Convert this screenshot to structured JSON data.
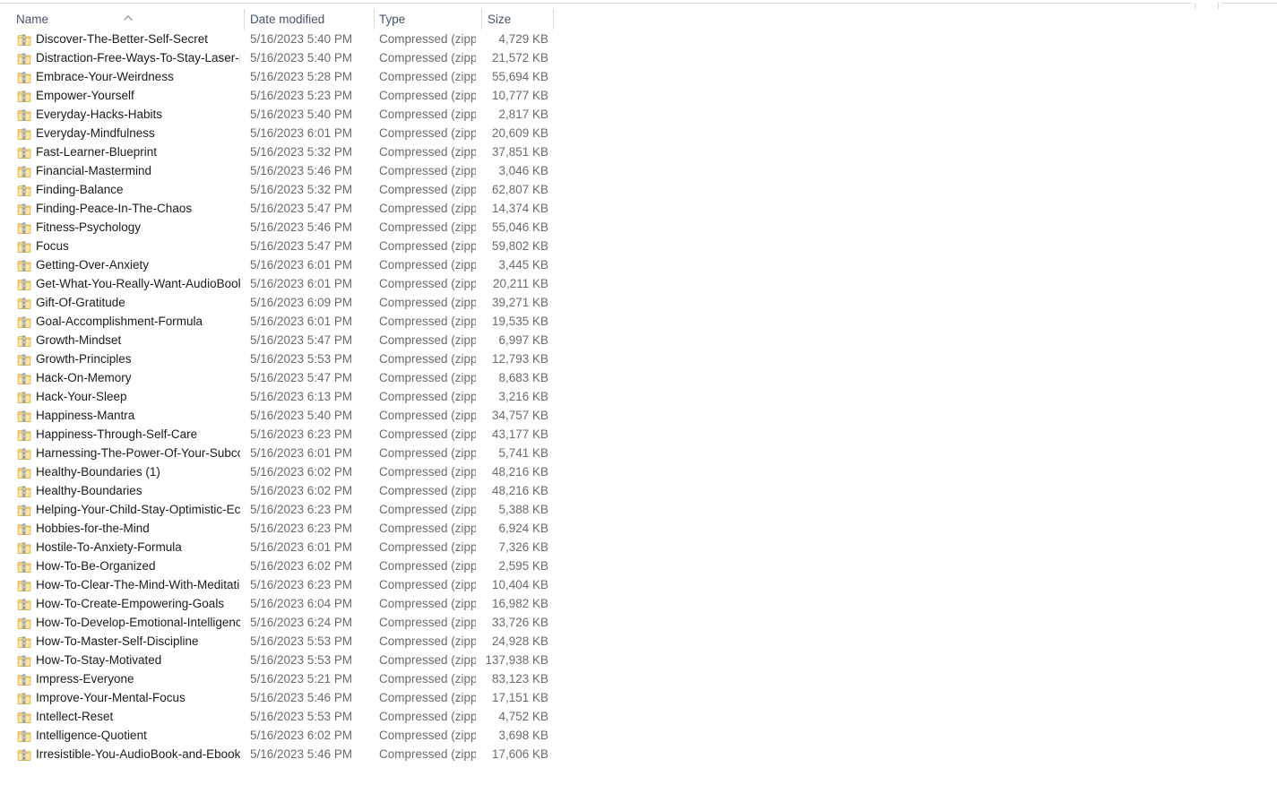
{
  "window": {
    "view_mode": "Details",
    "sort_column": "Name",
    "sort_direction": "ascending"
  },
  "columns": [
    {
      "key": "name",
      "label": "Name"
    },
    {
      "key": "date",
      "label": "Date modified"
    },
    {
      "key": "type",
      "label": "Type"
    },
    {
      "key": "size",
      "label": "Size"
    }
  ],
  "icons": {
    "zip": "zipped-folder-icon",
    "sort_ascending": "sort-ascending-chevron-icon"
  },
  "colors": {
    "header_text": "#44546a",
    "name_text": "#1b1b1b",
    "meta_text": "#6b6b6b",
    "divider": "#d9d9d9",
    "background": "#ffffff",
    "icon_folder": "#f6d77f",
    "icon_folder_dark": "#e0b94a"
  },
  "files": [
    {
      "name": "Discover-The-Better-Self-Secret",
      "date": "5/16/2023 5:40 PM",
      "type": "Compressed (zipp...",
      "size": "4,729 KB"
    },
    {
      "name": "Distraction-Free-Ways-To-Stay-Laser-Foc...",
      "date": "5/16/2023 5:40 PM",
      "type": "Compressed (zipp...",
      "size": "21,572 KB"
    },
    {
      "name": "Embrace-Your-Weirdness",
      "date": "5/16/2023 5:28 PM",
      "type": "Compressed (zipp...",
      "size": "55,694 KB"
    },
    {
      "name": "Empower-Yourself",
      "date": "5/16/2023 5:23 PM",
      "type": "Compressed (zipp...",
      "size": "10,777 KB"
    },
    {
      "name": "Everyday-Hacks-Habits",
      "date": "5/16/2023 5:40 PM",
      "type": "Compressed (zipp...",
      "size": "2,817 KB"
    },
    {
      "name": "Everyday-Mindfulness",
      "date": "5/16/2023 6:01 PM",
      "type": "Compressed (zipp...",
      "size": "20,609 KB"
    },
    {
      "name": "Fast-Learner-Blueprint",
      "date": "5/16/2023 5:32 PM",
      "type": "Compressed (zipp...",
      "size": "37,851 KB"
    },
    {
      "name": "Financial-Mastermind",
      "date": "5/16/2023 5:46 PM",
      "type": "Compressed (zipp...",
      "size": "3,046 KB"
    },
    {
      "name": "Finding-Balance",
      "date": "5/16/2023 5:32 PM",
      "type": "Compressed (zipp...",
      "size": "62,807 KB"
    },
    {
      "name": "Finding-Peace-In-The-Chaos",
      "date": "5/16/2023 5:47 PM",
      "type": "Compressed (zipp...",
      "size": "14,374 KB"
    },
    {
      "name": "Fitness-Psychology",
      "date": "5/16/2023 5:46 PM",
      "type": "Compressed (zipp...",
      "size": "55,046 KB"
    },
    {
      "name": "Focus",
      "date": "5/16/2023 5:47 PM",
      "type": "Compressed (zipp...",
      "size": "59,802 KB"
    },
    {
      "name": "Getting-Over-Anxiety",
      "date": "5/16/2023 6:01 PM",
      "type": "Compressed (zipp...",
      "size": "3,445 KB"
    },
    {
      "name": "Get-What-You-Really-Want-AudioBook-...",
      "date": "5/16/2023 6:01 PM",
      "type": "Compressed (zipp...",
      "size": "20,211 KB"
    },
    {
      "name": "Gift-Of-Gratitude",
      "date": "5/16/2023 6:09 PM",
      "type": "Compressed (zipp...",
      "size": "39,271 KB"
    },
    {
      "name": "Goal-Accomplishment-Formula",
      "date": "5/16/2023 6:01 PM",
      "type": "Compressed (zipp...",
      "size": "19,535 KB"
    },
    {
      "name": "Growth-Mindset",
      "date": "5/16/2023 5:47 PM",
      "type": "Compressed (zipp...",
      "size": "6,997 KB"
    },
    {
      "name": "Growth-Principles",
      "date": "5/16/2023 5:53 PM",
      "type": "Compressed (zipp...",
      "size": "12,793 KB"
    },
    {
      "name": "Hack-On-Memory",
      "date": "5/16/2023 5:47 PM",
      "type": "Compressed (zipp...",
      "size": "8,683 KB"
    },
    {
      "name": "Hack-Your-Sleep",
      "date": "5/16/2023 6:13 PM",
      "type": "Compressed (zipp...",
      "size": "3,216 KB"
    },
    {
      "name": "Happiness-Mantra",
      "date": "5/16/2023 5:40 PM",
      "type": "Compressed (zipp...",
      "size": "34,757 KB"
    },
    {
      "name": "Happiness-Through-Self-Care",
      "date": "5/16/2023 6:23 PM",
      "type": "Compressed (zipp...",
      "size": "43,177 KB"
    },
    {
      "name": "Harnessing-The-Power-Of-Your-Subcon...",
      "date": "5/16/2023 6:01 PM",
      "type": "Compressed (zipp...",
      "size": "5,741 KB"
    },
    {
      "name": "Healthy-Boundaries (1)",
      "date": "5/16/2023 6:02 PM",
      "type": "Compressed (zipp...",
      "size": "48,216 KB"
    },
    {
      "name": "Healthy-Boundaries",
      "date": "5/16/2023 6:02 PM",
      "type": "Compressed (zipp...",
      "size": "48,216 KB"
    },
    {
      "name": "Helping-Your-Child-Stay-Optimistic-Eco...",
      "date": "5/16/2023 6:23 PM",
      "type": "Compressed (zipp...",
      "size": "5,388 KB"
    },
    {
      "name": "Hobbies-for-the-Mind",
      "date": "5/16/2023 6:23 PM",
      "type": "Compressed (zipp...",
      "size": "6,924 KB"
    },
    {
      "name": "Hostile-To-Anxiety-Formula",
      "date": "5/16/2023 6:01 PM",
      "type": "Compressed (zipp...",
      "size": "7,326 KB"
    },
    {
      "name": "How-To-Be-Organized",
      "date": "5/16/2023 6:02 PM",
      "type": "Compressed (zipp...",
      "size": "2,595 KB"
    },
    {
      "name": "How-To-Clear-The-Mind-With-Meditation",
      "date": "5/16/2023 6:23 PM",
      "type": "Compressed (zipp...",
      "size": "10,404 KB"
    },
    {
      "name": "How-To-Create-Empowering-Goals",
      "date": "5/16/2023 6:04 PM",
      "type": "Compressed (zipp...",
      "size": "16,982 KB"
    },
    {
      "name": "How-To-Develop-Emotional-Intelligence",
      "date": "5/16/2023 6:24 PM",
      "type": "Compressed (zipp...",
      "size": "33,726 KB"
    },
    {
      "name": "How-To-Master-Self-Discipline",
      "date": "5/16/2023 5:53 PM",
      "type": "Compressed (zipp...",
      "size": "24,928 KB"
    },
    {
      "name": "How-To-Stay-Motivated",
      "date": "5/16/2023 5:53 PM",
      "type": "Compressed (zipp...",
      "size": "137,938 KB"
    },
    {
      "name": "Impress-Everyone",
      "date": "5/16/2023 5:21 PM",
      "type": "Compressed (zipp...",
      "size": "83,123 KB"
    },
    {
      "name": "Improve-Your-Mental-Focus",
      "date": "5/16/2023 5:46 PM",
      "type": "Compressed (zipp...",
      "size": "17,151 KB"
    },
    {
      "name": "Intellect-Reset",
      "date": "5/16/2023 5:53 PM",
      "type": "Compressed (zipp...",
      "size": "4,752 KB"
    },
    {
      "name": "Intelligence-Quotient",
      "date": "5/16/2023 6:02 PM",
      "type": "Compressed (zipp...",
      "size": "3,698 KB"
    },
    {
      "name": "Irresistible-You-AudioBook-and-Ebook",
      "date": "5/16/2023 5:46 PM",
      "type": "Compressed (zipp...",
      "size": "17,606 KB"
    }
  ]
}
